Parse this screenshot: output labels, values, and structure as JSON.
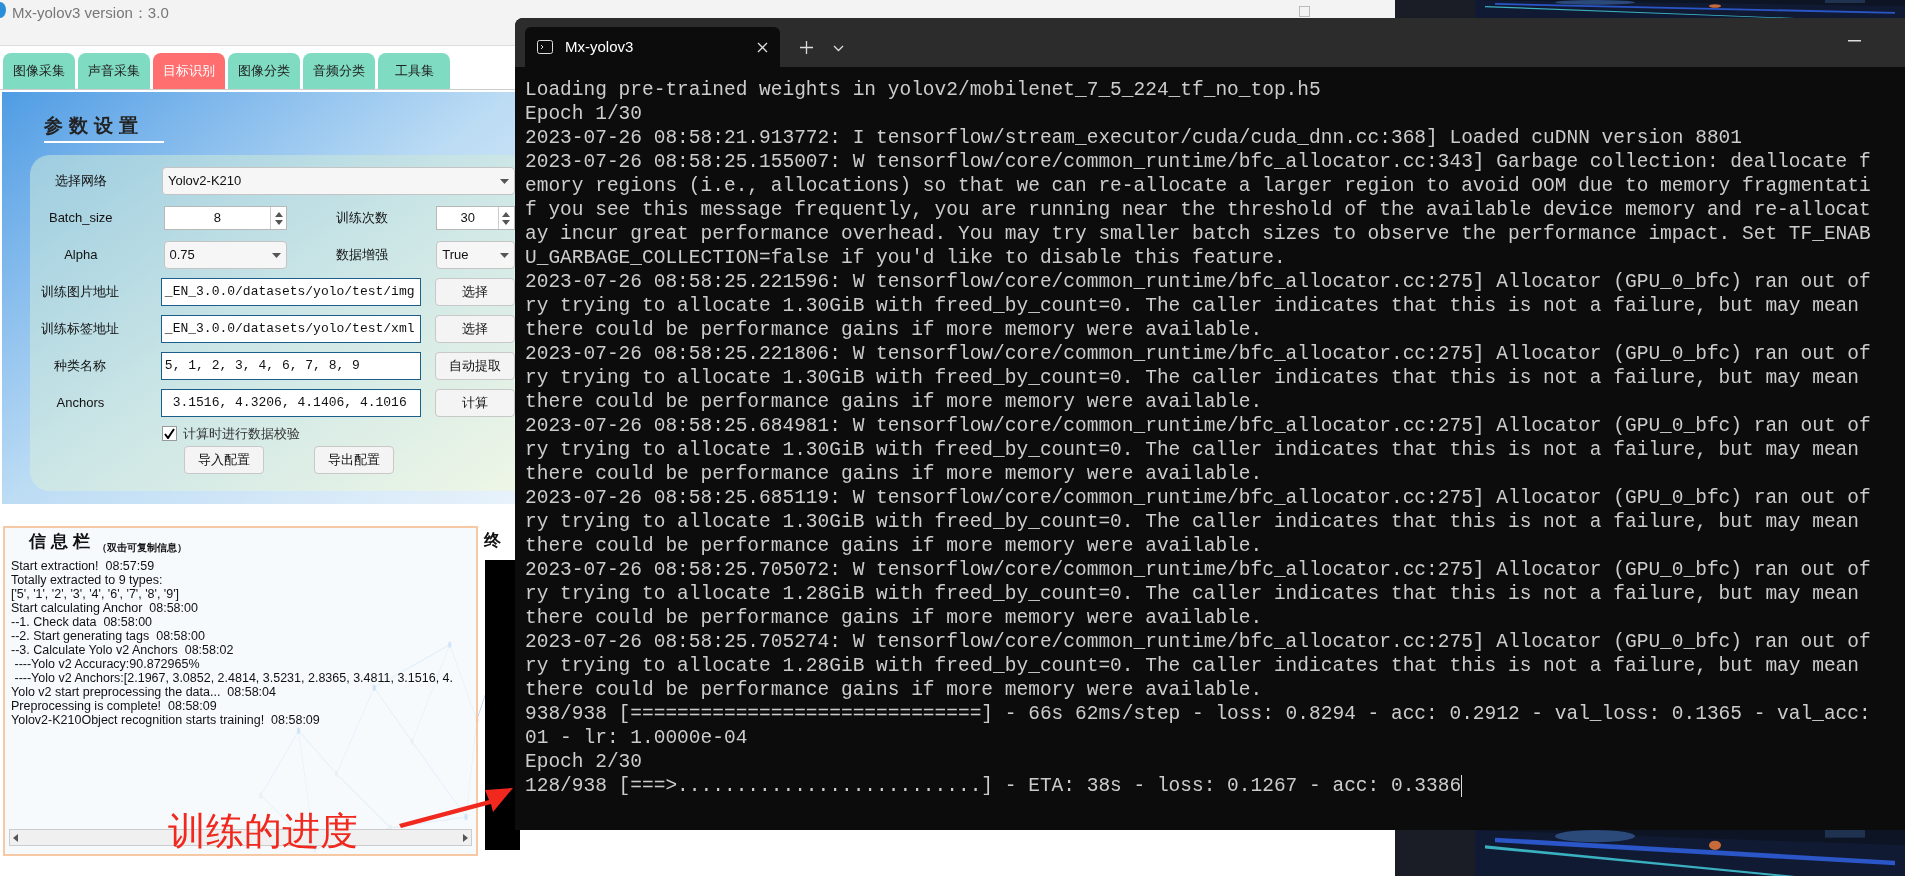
{
  "app": {
    "title": "Mx-yolov3 version：3.0",
    "tabs": [
      {
        "label": "图像采集",
        "selected": false
      },
      {
        "label": "声音采集",
        "selected": false
      },
      {
        "label": "目标识别",
        "selected": true
      },
      {
        "label": "图像分类",
        "selected": false
      },
      {
        "label": "音频分类",
        "selected": false
      },
      {
        "label": "工具集",
        "selected": false
      }
    ],
    "params": {
      "title": "参数设置",
      "network": {
        "label": "选择网络",
        "value": "Yolov2-K210"
      },
      "batch_size": {
        "label": "Batch_size",
        "value": "8"
      },
      "epochs": {
        "label": "训练次数",
        "value": "30"
      },
      "alpha": {
        "label": "Alpha",
        "value": "0.75"
      },
      "augment": {
        "label": "数据增强",
        "value": "True"
      },
      "image_path": {
        "label": "训练图片地址",
        "value": "_EN_3.0.0/datasets/yolo/test/img",
        "button": "选择"
      },
      "label_path": {
        "label": "训练标签地址",
        "value": "_EN_3.0.0/datasets/yolo/test/xml",
        "button": "选择"
      },
      "classes": {
        "label": "种类名称",
        "value": "5, 1, 2, 3, 4, 6, 7, 8, 9",
        "button": "自动提取"
      },
      "anchors": {
        "label": "Anchors",
        "value": " 3.1516, 4.3206, 4.1406, 4.1016",
        "button": "计算"
      },
      "check": {
        "label": "计算时进行数据校验",
        "checked": true
      },
      "buttons": [
        "导入配置",
        "导出配置"
      ]
    },
    "info": {
      "title": "信息栏",
      "hint": "（双击可复制信息）",
      "lines": [
        "Start extraction!  08:57:59",
        "Totally extracted to 9 types:",
        "['5', '1', '2', '3', '4', '6', '7', '8', '9']",
        "Start calculating Anchor  08:58:00",
        "--1. Check data  08:58:00",
        "--2. Start generating tags  08:58:00",
        "--3. Calculate Yolo v2 Anchors  08:58:02",
        " ----Yolo v2 Accuracy:90.872965%",
        " ----Yolo v2 Anchors:[2.1967, 3.0852, 2.4814, 3.5231, 2.8365, 3.4811, 3.1516, 4.",
        "Yolo v2 start preprocessing the data...  08:58:04",
        "Preprocessing is complete!  08:58:09",
        "Yolov2-K210Object recognition starts training!  08:58:09"
      ]
    },
    "terminal_panel": {
      "title": "终"
    }
  },
  "terminal": {
    "tab_title": "Mx-yolov3",
    "lines": [
      "Loading pre-trained weights in yolov2/mobilenet_7_5_224_tf_no_top.h5",
      "Epoch 1/30",
      "2023-07-26 08:58:21.913772: I tensorflow/stream_executor/cuda/cuda_dnn.cc:368] Loaded cuDNN version 8801",
      "2023-07-26 08:58:25.155007: W tensorflow/core/common_runtime/bfc_allocator.cc:343] Garbage collection: deallocate f",
      "emory regions (i.e., allocations) so that we can re-allocate a larger region to avoid OOM due to memory fragmentati",
      "f you see this message frequently, you are running near the threshold of the available device memory and re-allocat",
      "ay incur great performance overhead. You may try smaller batch sizes to observe the performance impact. Set TF_ENAB",
      "U_GARBAGE_COLLECTION=false if you'd like to disable this feature.",
      "2023-07-26 08:58:25.221596: W tensorflow/core/common_runtime/bfc_allocator.cc:275] Allocator (GPU_0_bfc) ran out of",
      "ry trying to allocate 1.30GiB with freed_by_count=0. The caller indicates that this is not a failure, but may mean",
      "there could be performance gains if more memory were available.",
      "2023-07-26 08:58:25.221806: W tensorflow/core/common_runtime/bfc_allocator.cc:275] Allocator (GPU_0_bfc) ran out of",
      "ry trying to allocate 1.30GiB with freed_by_count=0. The caller indicates that this is not a failure, but may mean",
      "there could be performance gains if more memory were available.",
      "2023-07-26 08:58:25.684981: W tensorflow/core/common_runtime/bfc_allocator.cc:275] Allocator (GPU_0_bfc) ran out of",
      "ry trying to allocate 1.30GiB with freed_by_count=0. The caller indicates that this is not a failure, but may mean",
      "there could be performance gains if more memory were available.",
      "2023-07-26 08:58:25.685119: W tensorflow/core/common_runtime/bfc_allocator.cc:275] Allocator (GPU_0_bfc) ran out of",
      "ry trying to allocate 1.30GiB with freed_by_count=0. The caller indicates that this is not a failure, but may mean",
      "there could be performance gains if more memory were available.",
      "2023-07-26 08:58:25.705072: W tensorflow/core/common_runtime/bfc_allocator.cc:275] Allocator (GPU_0_bfc) ran out of",
      "ry trying to allocate 1.28GiB with freed_by_count=0. The caller indicates that this is not a failure, but may mean",
      "there could be performance gains if more memory were available.",
      "2023-07-26 08:58:25.705274: W tensorflow/core/common_runtime/bfc_allocator.cc:275] Allocator (GPU_0_bfc) ran out of",
      "ry trying to allocate 1.28GiB with freed_by_count=0. The caller indicates that this is not a failure, but may mean",
      "there could be performance gains if more memory were available.",
      "938/938 [==============================] - 66s 62ms/step - loss: 0.8294 - acc: 0.2912 - val_loss: 0.1365 - val_acc:",
      "01 - lr: 1.0000e-04",
      "Epoch 2/30",
      "128/938 [===>..........................] - ETA: 38s - loss: 0.1267 - acc: 0.3386"
    ]
  },
  "annotation": {
    "text": "训练的进度"
  }
}
